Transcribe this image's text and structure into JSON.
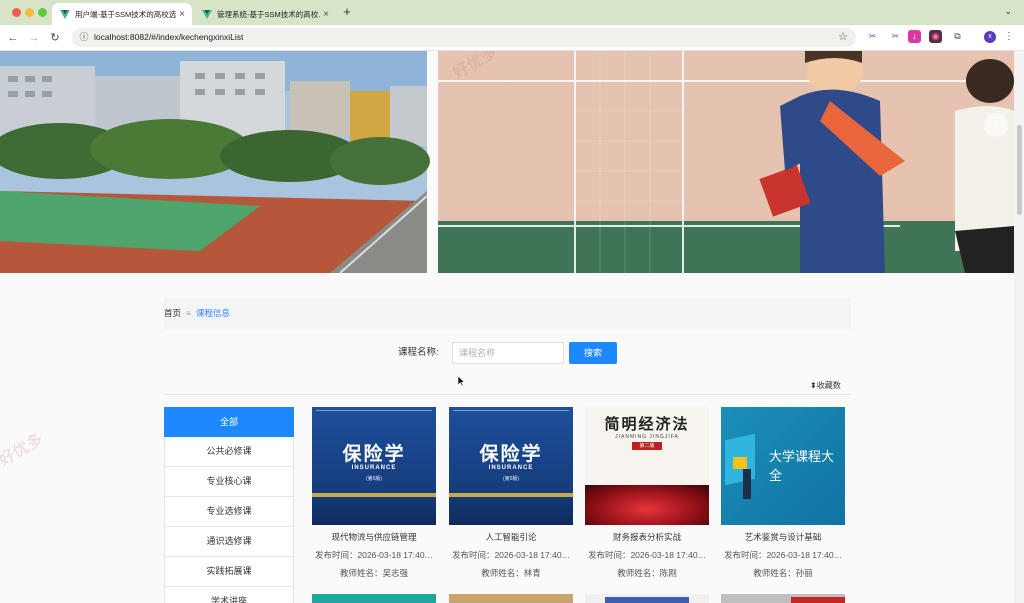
{
  "browser": {
    "tabs": [
      {
        "title": "用户端-基于SSM技术的高校选…",
        "active": true
      },
      {
        "title": "管理系统-基于SSM技术的高校…",
        "active": false
      }
    ],
    "new_tab": "+",
    "url": "localhost:8082/#/index/kechengxinxiList",
    "profile_initial": "x"
  },
  "breadcrumb": {
    "home": "首页",
    "separator": "≡",
    "current": "课程信息"
  },
  "search": {
    "label": "课程名称:",
    "placeholder": "课程名称",
    "button": "搜索"
  },
  "sort": {
    "label": "⬍收藏数"
  },
  "categories": [
    "全部",
    "公共必修课",
    "专业核心课",
    "专业选修课",
    "通识选修课",
    "实践拓展课",
    "学术讲座"
  ],
  "courses": [
    {
      "name": "现代物流与供应链管理",
      "date": "发布时间：2026-03-18 17:40…",
      "teacher": "教师姓名：吴志强",
      "cover_title": "保险学",
      "cover_sub": "INSURANCE",
      "cover_edition": "(第5版)"
    },
    {
      "name": "人工智能引论",
      "date": "发布时间：2026-03-18 17:40…",
      "teacher": "教师姓名：林青",
      "cover_title": "保险学",
      "cover_sub": "INSURANCE",
      "cover_edition": "(第5版)"
    },
    {
      "name": "财务报表分析实战",
      "date": "发布时间：2026-03-18 17:40…",
      "teacher": "教师姓名：陈刚",
      "cover_title": "简明经济法",
      "cover_sub": "JIANMING JINGJIFA",
      "cover_edition": "第二版"
    },
    {
      "name": "艺术鉴赏与设计基础",
      "date": "发布时间：2026-03-18 17:40…",
      "teacher": "教师姓名：孙丽",
      "cover_title": "大学课程大全",
      "cover_sub": "",
      "cover_edition": ""
    }
  ],
  "watermark": "好优多",
  "colors": {
    "accent": "#1e88ff",
    "link": "#3b82f6",
    "tabbar": "#d6e4c8"
  }
}
